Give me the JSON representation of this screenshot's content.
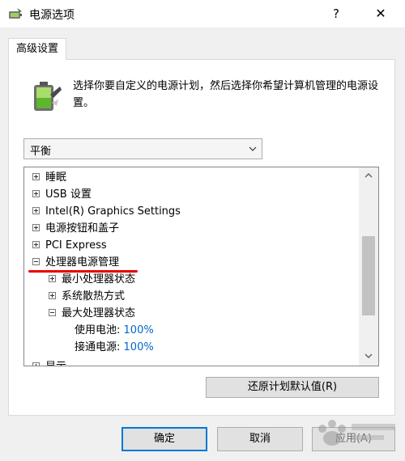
{
  "window": {
    "title": "电源选项",
    "help_glyph": "?",
    "close_glyph": "✕",
    "app_icon": "power-options-icon"
  },
  "tab": {
    "label": "高级设置"
  },
  "description": "选择你要自定义的电源计划，然后选择你希望计算机管理的电源设置。",
  "plan_select": {
    "selected": "平衡"
  },
  "tree": {
    "items": [
      {
        "label": "睡眠",
        "expander": "plus"
      },
      {
        "label": "USB 设置",
        "expander": "plus"
      },
      {
        "label": "Intel(R) Graphics Settings",
        "expander": "plus"
      },
      {
        "label": "电源按钮和盖子",
        "expander": "plus"
      },
      {
        "label": "PCI Express",
        "expander": "plus"
      },
      {
        "label": "处理器电源管理",
        "expander": "minus"
      },
      {
        "label": "最小处理器状态",
        "expander": "plus"
      },
      {
        "label": "系统散热方式",
        "expander": "plus"
      },
      {
        "label": "最大处理器状态",
        "expander": "minus"
      },
      {
        "label": "使用电池:",
        "value": "100%"
      },
      {
        "label": "接通电源:",
        "value": "100%"
      },
      {
        "label": "显示",
        "expander": "plus"
      }
    ]
  },
  "buttons": {
    "restore": "还原计划默认值(R)",
    "ok": "确定",
    "cancel": "取消",
    "apply": "应用(A)"
  },
  "colors": {
    "accent": "#0078d7",
    "link": "#0066cc",
    "highlight_underline": "#e60000"
  }
}
